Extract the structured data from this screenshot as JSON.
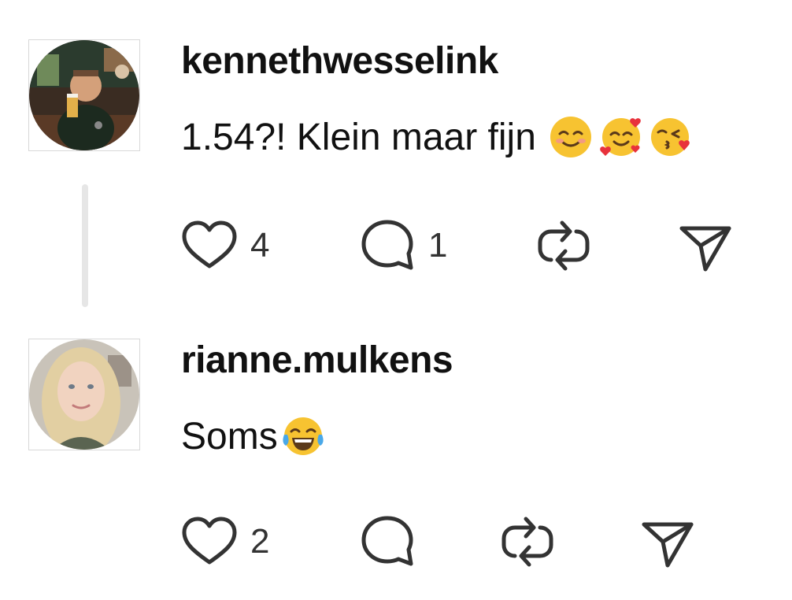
{
  "comments": [
    {
      "username": "kennethwesselink",
      "text": "1.54?! Klein maar fijn",
      "emojis": [
        "smiling-face-emoji",
        "smiling-face-with-hearts-emoji",
        "face-blowing-kiss-emoji"
      ],
      "likes": "4",
      "replies": "1",
      "has_thread_line": true
    },
    {
      "username": "rianne.mulkens",
      "text": "Soms",
      "emojis": [
        "face-with-tears-of-joy-emoji"
      ],
      "likes": "2",
      "replies": "",
      "has_thread_line": false
    }
  ],
  "icons": {
    "like": "heart-icon",
    "reply": "comment-bubble-icon",
    "repost": "repost-icon",
    "share": "send-icon"
  },
  "colors": {
    "text": "#111111",
    "icon": "#333333",
    "thread_line": "#e6e6e6",
    "emoji_yellow": "#f7c331",
    "heart_red": "#e8323c"
  }
}
